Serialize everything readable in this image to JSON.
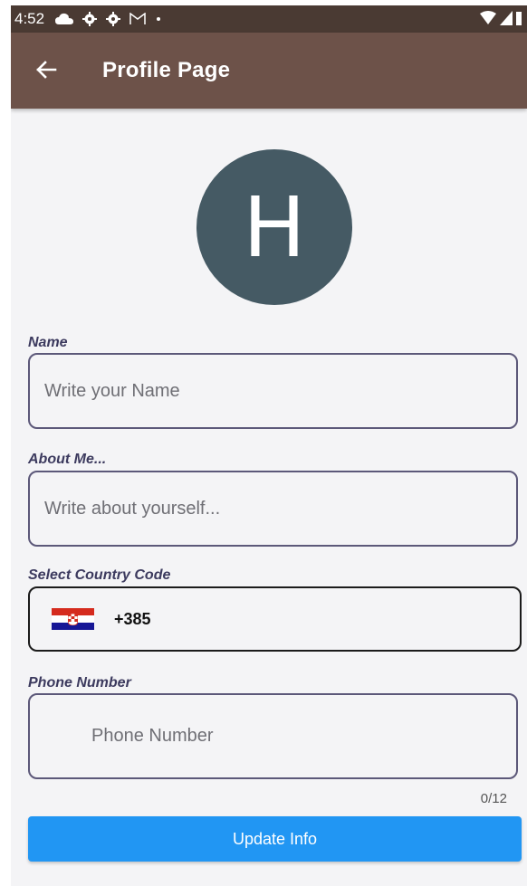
{
  "status_bar": {
    "time": "4:52",
    "icons": [
      "cloud-icon",
      "gear-icon",
      "gear-icon",
      "gmail-icon",
      "dot-icon"
    ],
    "right_icons": [
      "wifi-icon",
      "signal-icon",
      "battery-icon"
    ]
  },
  "app_bar": {
    "title": "Profile Page",
    "back_icon": "arrow-left-icon"
  },
  "avatar": {
    "initial": "H",
    "color": "#455a64"
  },
  "form": {
    "name": {
      "label": "Name",
      "placeholder": "Write your Name",
      "value": ""
    },
    "about": {
      "label": "About Me...",
      "placeholder": "Write about yourself...",
      "value": ""
    },
    "country": {
      "label": "Select Country Code",
      "flag": "croatia-flag-icon",
      "dial_code": "+385"
    },
    "phone": {
      "label": "Phone Number",
      "placeholder": "Phone Number",
      "value": "",
      "counter": "0/12"
    }
  },
  "update_button": {
    "label": "Update Info",
    "color": "#2196f3"
  },
  "colors": {
    "status_bar": "#4a3a33",
    "app_bar": "#6d5249",
    "label": "#3c3a5e",
    "field_border": "#5c5879"
  }
}
